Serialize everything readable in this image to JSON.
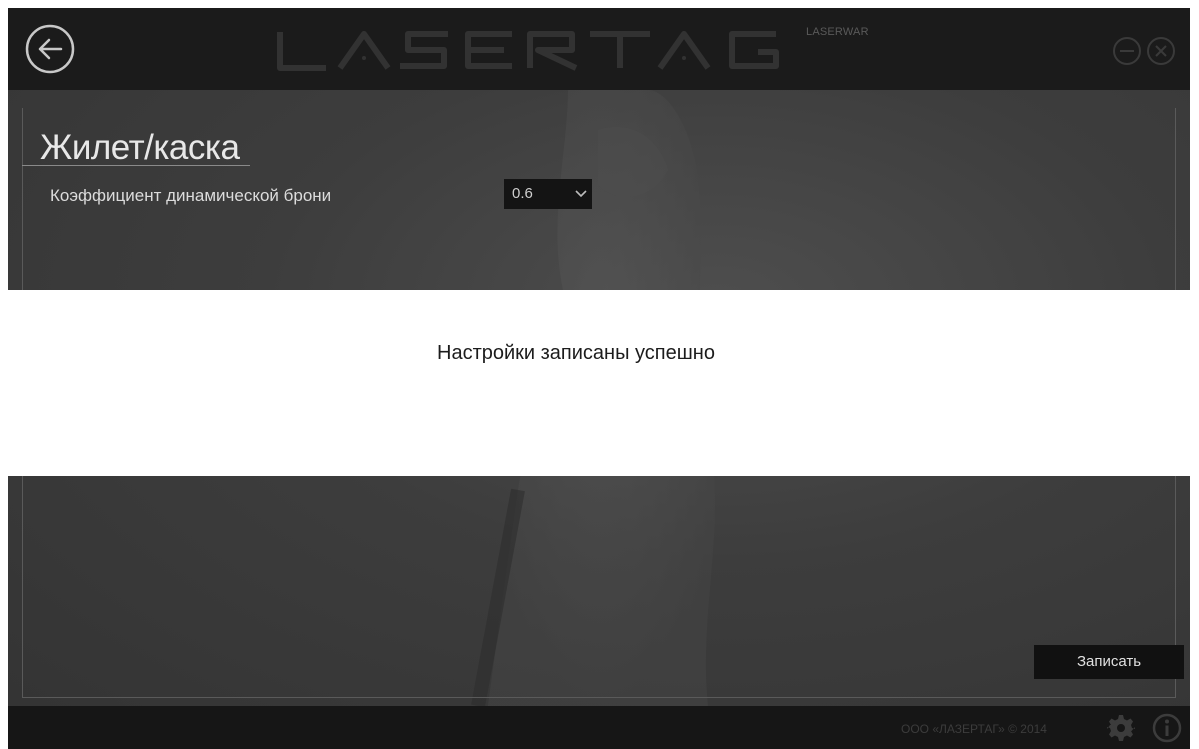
{
  "window": {
    "logo_text": "LASERTAG",
    "logo_sub": "LASERWAR",
    "colors": {
      "titlebar": "#1b1b1b",
      "content_bg": "#3d3d3d",
      "dialog_bg": "#ffffff",
      "button_bg": "#111111"
    }
  },
  "page": {
    "title": "Жилет/каска",
    "fields": {
      "armor_label": "Коэффициент динамической брони",
      "armor_value": "0.6"
    },
    "write_button": "Записать"
  },
  "footer": {
    "copyright": "ООО «ЛАЗЕРТАГ» © 2014"
  },
  "dialog": {
    "message": "Настройки записаны успешно"
  },
  "icons": {
    "back": "arrow-left-circle-icon",
    "minimize": "minus-circle-icon",
    "close": "x-circle-icon",
    "settings": "gear-icon",
    "info": "info-circle-icon",
    "dropdown": "chevron-down-icon"
  }
}
